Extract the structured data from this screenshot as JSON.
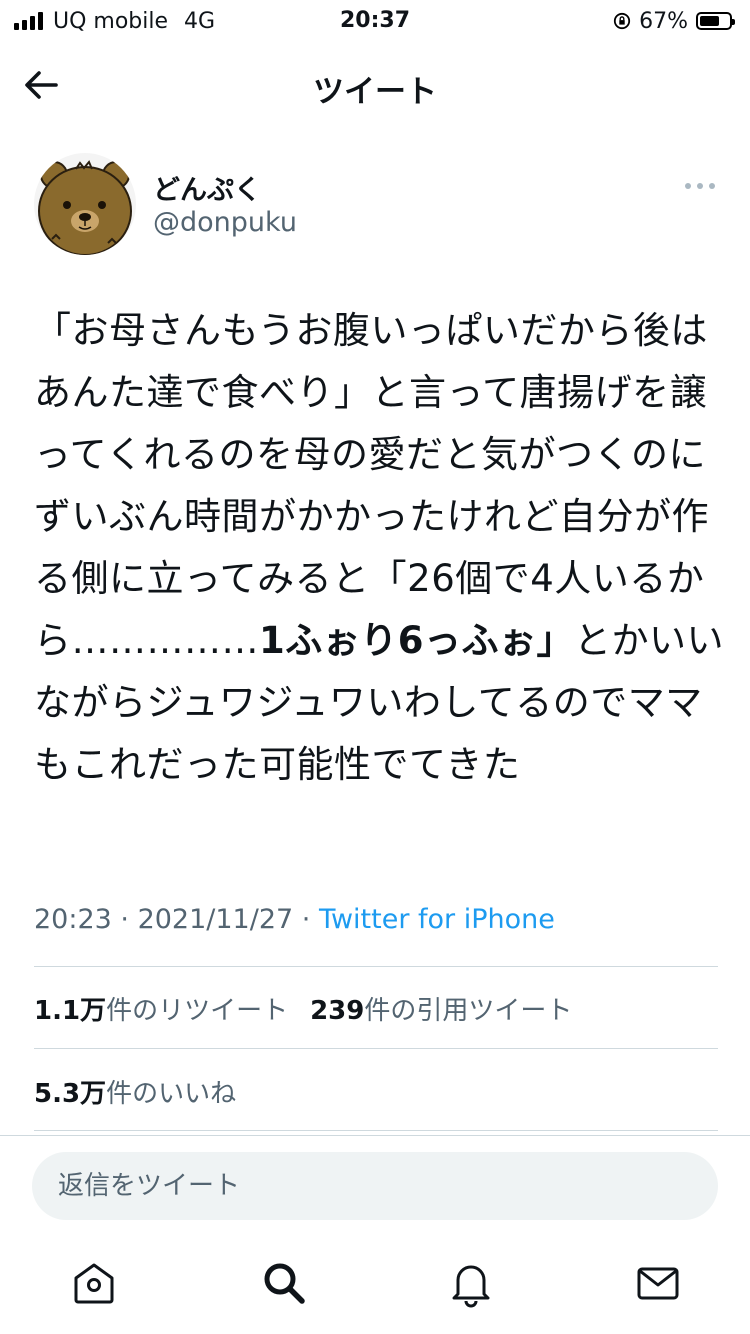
{
  "status_bar": {
    "carrier": "UQ mobile",
    "network": "4G",
    "time": "20:37",
    "battery": "67%",
    "battery_level": 0.67
  },
  "header": {
    "title": "ツイート",
    "back_icon": "arrow-left-icon"
  },
  "tweet": {
    "author_name": "どんぷく",
    "author_handle": "@donpuku",
    "text_before_bold": "「お母さんもうお腹いっぱいだから後はあんた達で食べり」と言って唐揚げを譲ってくれるのを母の愛だと気がつくのにずいぶん時間がかかったけれど自分が作る側に立ってみると「26個で4人いるから……………",
    "text_bold": "1ふぉり6っふぉ」",
    "text_after_bold": "とかいいながらジュワジュワいわしてるのでママもこれだった可能性でてきた",
    "time": "20:23",
    "date": "2021/11/27",
    "separator": " · ",
    "source": "Twitter for iPhone"
  },
  "stats": {
    "retweets_count": "1.1万",
    "retweets_label": "件のリツイート",
    "quotes_count": "239",
    "quotes_label": "件の引用ツイート",
    "likes_count": "5.3万",
    "likes_label": "件のいいね"
  },
  "reply": {
    "placeholder": "返信をツイート"
  },
  "tab_bar": {
    "items": [
      "home-icon",
      "search-icon",
      "notifications-bell-icon",
      "messages-envelope-icon"
    ]
  },
  "colors": {
    "text": "#0f1419",
    "secondary": "#536471",
    "link": "#1d9bf0",
    "divider": "#cfd9de",
    "reply_bg": "#eff3f4"
  }
}
